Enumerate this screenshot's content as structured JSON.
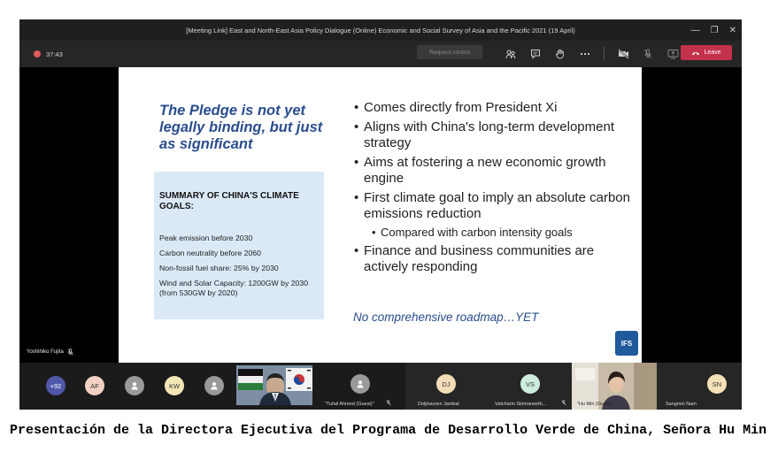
{
  "window": {
    "title": "[Meeting Link] East and North-East Asia Policy Dialogue (Online) Economic and Social Survey of Asia and the Pacific 2021 (19 April)",
    "controls": {
      "minimize": "—",
      "restore": "❐",
      "close": "✕"
    }
  },
  "toolbar": {
    "timer": "37:43",
    "request_control_label": "Request control",
    "leave_label": "Leave",
    "icons": [
      "people-icon",
      "chat-icon",
      "raise-hand-icon",
      "more-icon",
      "camera-off-icon",
      "mic-off-icon",
      "share-icon"
    ]
  },
  "slide": {
    "pledge_heading": "The Pledge is not yet legally binding, but just as significant",
    "summary_title": "SUMMARY OF CHINA'S CLIMATE GOALS:",
    "summary_items": [
      "Peak emission before 2030",
      "Carbon neutrality before 2060",
      "Non-fossil fuel share: 25% by 2030",
      "Wind and Solar Capacity: 1200GW by 2030 (from 530GW by 2020)"
    ],
    "bullets": [
      "Comes directly from President Xi",
      "Aligns with China's long-term development strategy",
      "Aims at fostering a new economic growth engine",
      "First climate goal to imply an absolute carbon emissions reduction",
      "Finance and business communities are actively responding"
    ],
    "sub_bullet": "Compared with carbon intensity goals",
    "roadmap": "No comprehensive roadmap…YET",
    "logo_text": "IFS"
  },
  "presenter": {
    "name": "Yoshihiko Fujita"
  },
  "participants": {
    "overflow": "+92",
    "initials": [
      "AF",
      "KW"
    ],
    "tiles": [
      {
        "name": "\"Tufail Ahmed (Guest)\"",
        "initials": ""
      },
      {
        "name": "Doljinsuren Jambal",
        "initials": "DJ"
      },
      {
        "name": "Vatcharin Sirimaneeth...",
        "initials": "VS"
      },
      {
        "name": "\"Hu Min (Guest)\"",
        "initials": ""
      },
      {
        "name": "Sangmin Nam",
        "initials": "SN"
      }
    ],
    "colors": {
      "more": "#4f58a8",
      "af": "#f3d1c2",
      "kw": "#f5e6b8",
      "dj": "#f5dcb8",
      "vs": "#cdeede",
      "sn": "#f5e1b8"
    }
  },
  "caption": "Presentación de la Directora Ejecutiva del Programa de Desarrollo Verde de China, Señora Hu Min"
}
